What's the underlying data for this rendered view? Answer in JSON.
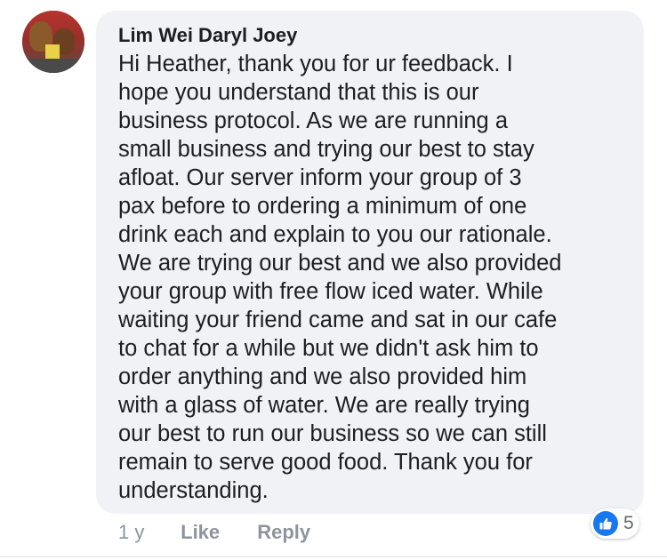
{
  "comment": {
    "author": "Lim Wei Daryl Joey",
    "lines": [
      "Hi Heather, thank you for ur feedback. I",
      "hope you understand that this is our",
      "business protocol. As we are running a",
      "small business and trying our best to stay",
      "afloat. Our server inform your group of 3",
      "pax before to ordering a minimum of one",
      "drink each and explain to you our rationale.",
      "We are trying our best and we also provided",
      "your group with free flow iced water. While",
      "waiting your friend came and sat in our cafe",
      "to chat for a while but we didn't ask him to",
      "order anything and we also provided him",
      "with a glass of water. We are really trying",
      "our best to run our business so we can still",
      "remain to serve good food. Thank you for",
      "understanding."
    ],
    "time": "1 y",
    "like_label": "Like",
    "reply_label": "Reply",
    "reaction_icon": "thumbs-up-icon",
    "reaction_count": "5"
  },
  "colors": {
    "bubble": "#f1f2f6",
    "text": "#1c1e21",
    "meta": "#8d949e",
    "like_blue": "#1877f2"
  }
}
